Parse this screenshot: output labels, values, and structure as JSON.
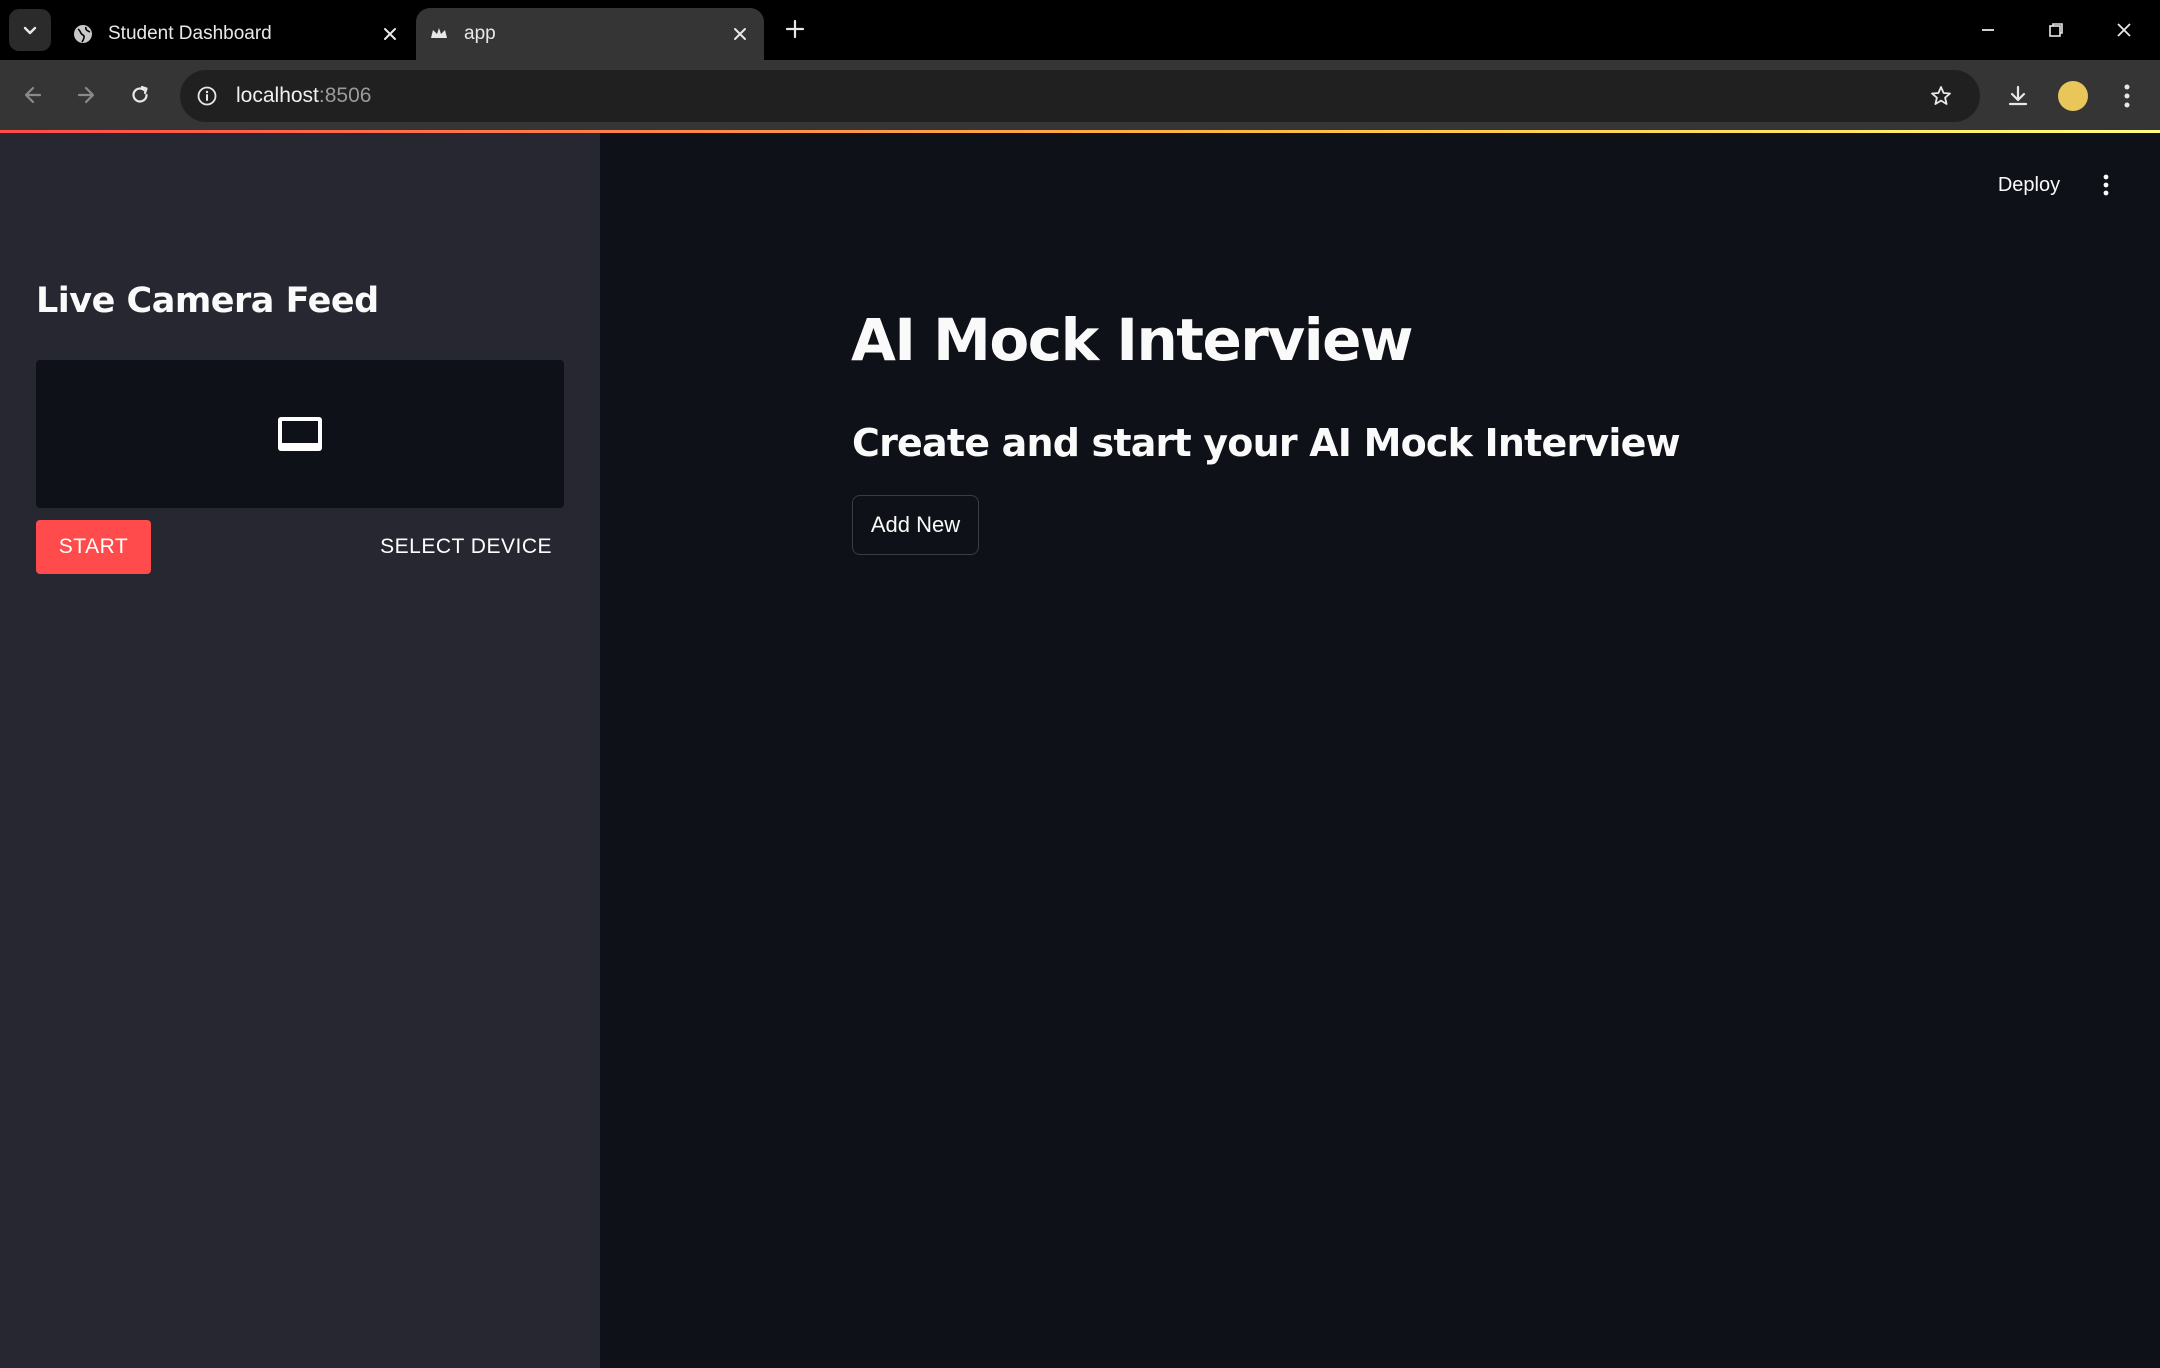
{
  "browser": {
    "tabs": [
      {
        "title": "Student Dashboard",
        "favicon": "globe-icon",
        "active": false
      },
      {
        "title": "app",
        "favicon": "streamlit-crown-icon",
        "active": true
      }
    ],
    "address": {
      "host": "localhost",
      "port": ":8506"
    }
  },
  "app": {
    "header": {
      "deploy_label": "Deploy"
    },
    "sidebar": {
      "title": "Live Camera Feed",
      "start_label": "START",
      "select_device_label": "SELECT DEVICE"
    },
    "main": {
      "title": "AI Mock Interview",
      "subtitle": "Create and start your AI Mock Interview",
      "add_new_label": "Add New"
    }
  },
  "colors": {
    "accent": "#ff4b4b",
    "sidebar_bg": "#262730",
    "main_bg": "#0e1117"
  }
}
